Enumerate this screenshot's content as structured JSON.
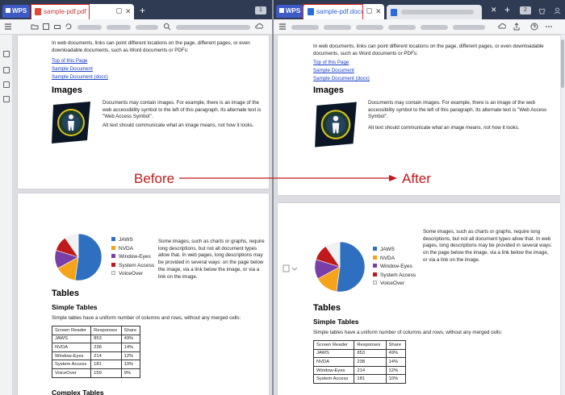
{
  "app": {
    "brand": "WPS",
    "left_tab": "sample-pdf.pdf",
    "right_tab": "sample-pdf.docx",
    "left_badge": "1",
    "right_badge": "2",
    "new_tab": "+",
    "close": "✕"
  },
  "annotation": {
    "before": "Before",
    "after": "After",
    "color": "#c0191b"
  },
  "doc": {
    "intro": "In web documents, links can point different locations on the page, different pages, or even downloadable documents, such as Word documents or PDFs:",
    "links": [
      "Top of this Page",
      "Sample Document",
      "Sample Document (docx)"
    ],
    "images_heading": "Images",
    "images_para": "Documents may contain images. For example, there is an image of the web accessibility symbol to the left of this paragraph. Its alternate text is \"Web Access Symbol\".",
    "alt_para": "Alt text should communicate what an image means, not how it looks.",
    "chart_para": "Some images, such as charts or graphs, require long descriptions, but not all document types allow that. In web pages, long descriptions may be provided in several ways: on the page below the image, via a link below the image, or via a link on the image.",
    "tables_heading": "Tables",
    "simple_heading": "Simple Tables",
    "simple_para": "Simple tables have a uniform number of columns and rows, without any merged cells:",
    "complex_heading": "Complex Tables",
    "table": {
      "headers": [
        "Screen Reader",
        "Responses",
        "Share"
      ],
      "rows": [
        [
          "JAWS",
          "853",
          "49%"
        ],
        [
          "NVDA",
          "238",
          "14%"
        ],
        [
          "Window-Eyes",
          "214",
          "12%"
        ],
        [
          "System Access",
          "181",
          "10%"
        ],
        [
          "VoiceOver",
          "159",
          "9%"
        ]
      ]
    }
  },
  "chart_data": {
    "type": "pie",
    "categories": [
      "JAWS",
      "NVDA",
      "Window-Eyes",
      "System Access",
      "VoiceOver"
    ],
    "values": [
      49,
      14,
      12,
      10,
      9
    ],
    "colors": [
      "#2f6fbf",
      "#f5a31a",
      "#7a3fa6",
      "#c0191b",
      "#f1f1f1"
    ],
    "legend": "right"
  }
}
